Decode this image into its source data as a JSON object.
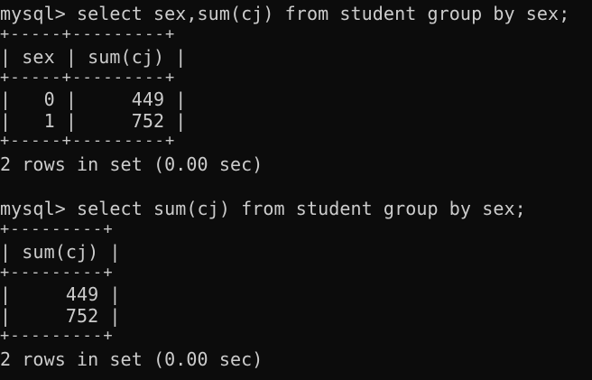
{
  "terminal": {
    "query1": {
      "prompt": "mysql> select sex,sum(cj) from student group by sex;",
      "border_top": "+-----+---------+",
      "header": "| sex | sum(cj) |",
      "border_mid": "+-----+---------+",
      "rows": [
        "|   0 |     449 |",
        "|   1 |     752 |"
      ],
      "border_bottom": "+-----+---------+",
      "result": "2 rows in set (0.00 sec)"
    },
    "query2": {
      "prompt": "mysql> select sum(cj) from student group by sex;",
      "border_top": "+---------+",
      "header": "| sum(cj) |",
      "border_mid": "+---------+",
      "rows": [
        "|     449 |",
        "|     752 |"
      ],
      "border_bottom": "+---------+",
      "result": "2 rows in set (0.00 sec)"
    }
  }
}
